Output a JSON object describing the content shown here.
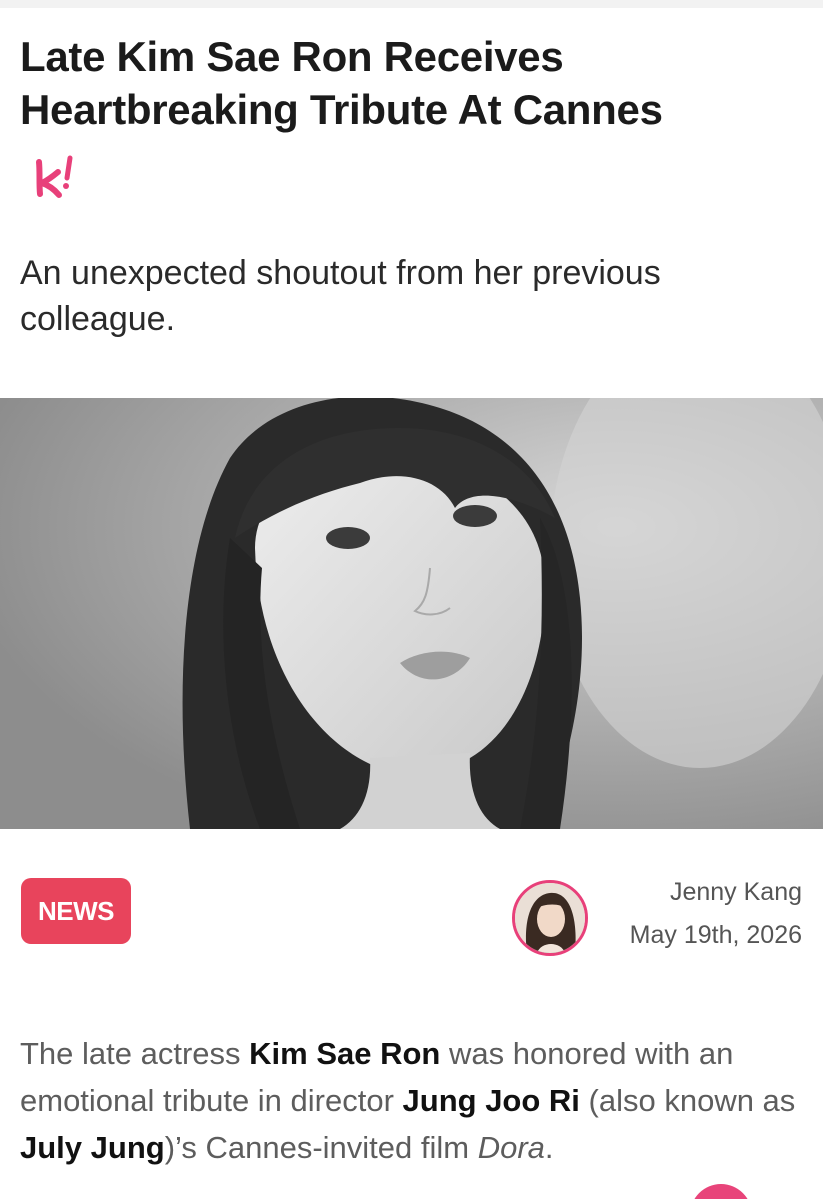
{
  "article": {
    "title": "Late Kim Sae Ron Receives Heartbreaking Tribute At Cannes",
    "subtitle": "An unexpected shoutout from her previous colleague.",
    "brand_icon": "koreaboo-k-logo",
    "hero_image": "portrait-photo-black-and-white",
    "category_tag": "NEWS",
    "author": {
      "name": "Jenny Kang",
      "date": "May 19th, 2026",
      "avatar_icon": "author-avatar"
    },
    "body": {
      "p1_a": "The late actress ",
      "p1_b": "Kim Sae Ron",
      "p1_c": " was honored with an emotional tribute in director ",
      "p1_d": "Jung Joo Ri",
      "p1_e": " (also known as ",
      "p1_f": "July Jung",
      "p1_g": ")’s Cannes-invited film ",
      "p1_h": "Dora",
      "p1_i": "."
    }
  },
  "colors": {
    "accent": "#e8445c",
    "brand_pink": "#e8407a",
    "heading": "#1b1b1b",
    "body_text": "#5d5d5d"
  }
}
